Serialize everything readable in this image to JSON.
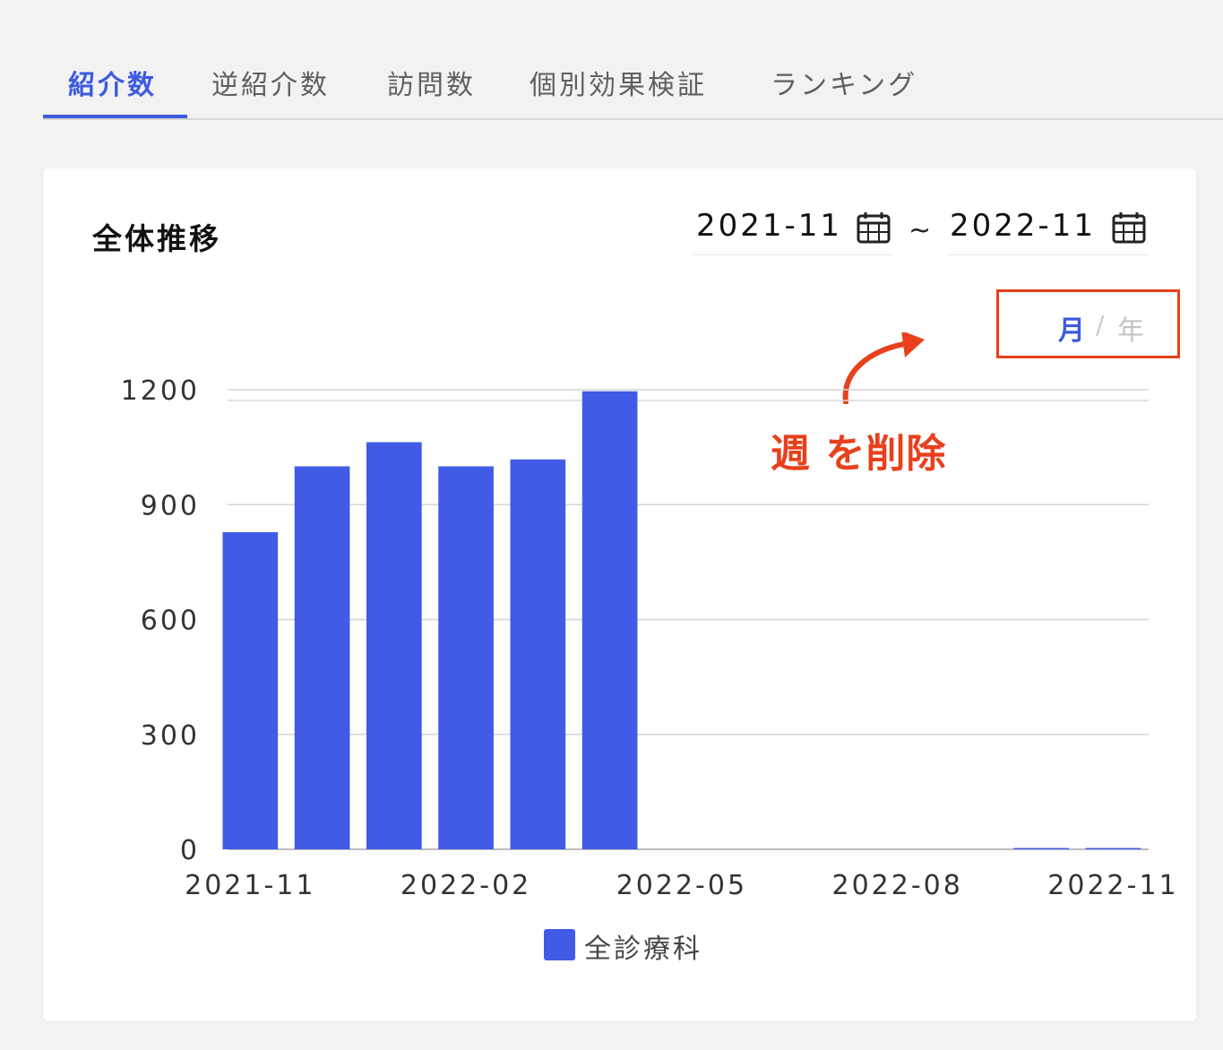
{
  "tabs": [
    {
      "label": "紹介数",
      "active": true
    },
    {
      "label": "逆紹介数",
      "active": false
    },
    {
      "label": "訪問数",
      "active": false
    },
    {
      "label": "個別効果検証",
      "active": false
    },
    {
      "label": "ランキング",
      "active": false
    }
  ],
  "card": {
    "title": "全体推移",
    "date_from": "2021-11",
    "date_to": "2022-11",
    "date_separator": "~",
    "period_month": "月",
    "period_separator": "/",
    "period_year": "年",
    "annotation": "週 を削除"
  },
  "colors": {
    "accent": "#3d5ae0",
    "bar": "#415be6",
    "annotation": "#e8401c"
  },
  "icons": [
    "calendar-icon",
    "calendar-icon"
  ],
  "chart_data": {
    "type": "bar",
    "categories": [
      "2021-11",
      "2021-12",
      "2022-01",
      "2022-02",
      "2022-03",
      "2022-04",
      "2022-05",
      "2022-06",
      "2022-07",
      "2022-08",
      "2022-09",
      "2022-10",
      "2022-11"
    ],
    "x_tick_labels": [
      "2021-11",
      "2022-02",
      "2022-05",
      "2022-08",
      "2022-11"
    ],
    "y_ticks": [
      0,
      300,
      900,
      600,
      1200
    ],
    "ylim": [
      0,
      1200
    ],
    "series": [
      {
        "name": "全診療科",
        "values": [
          828,
          1000,
          1063,
          1000,
          1018,
          1196,
          0,
          0,
          0,
          0,
          0,
          1,
          1
        ]
      }
    ],
    "grid": true,
    "legend_position": "bottom"
  }
}
